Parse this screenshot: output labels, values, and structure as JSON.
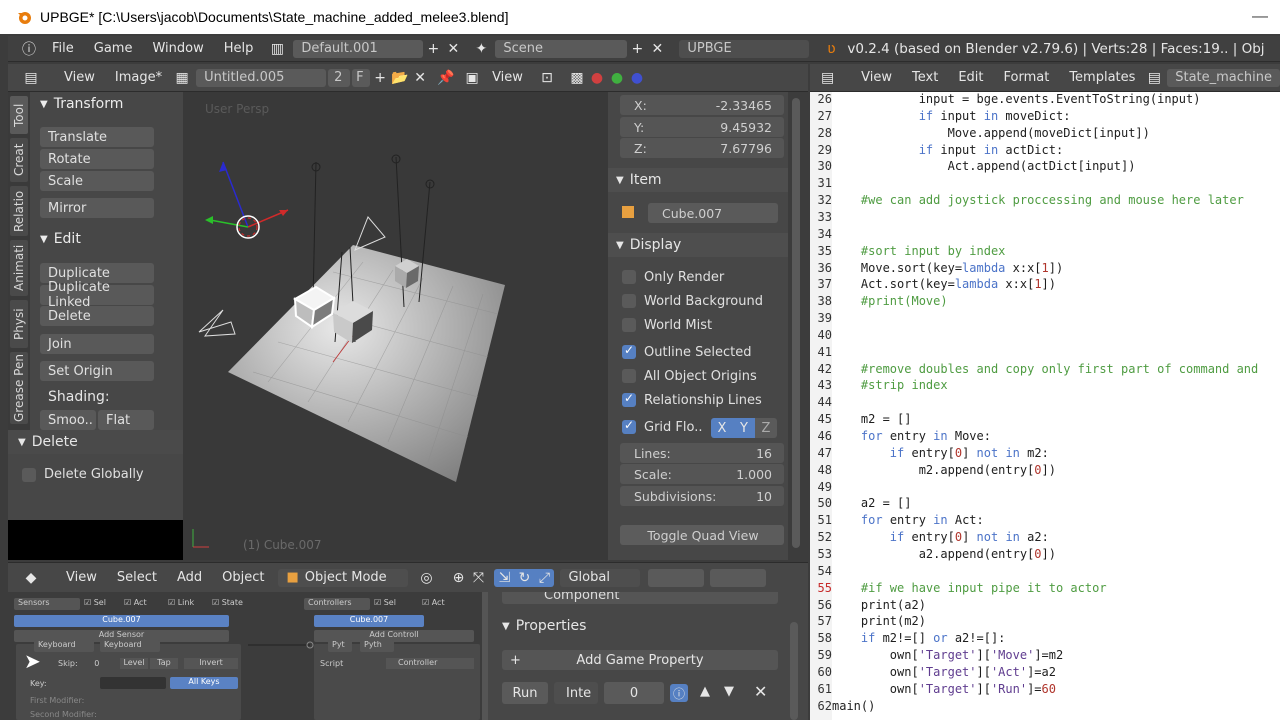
{
  "window": {
    "title": "UPBGE* [C:\\Users\\jacob\\Documents\\State_machine_added_melee3.blend]"
  },
  "infobar": {
    "menus": [
      "File",
      "Game",
      "Window",
      "Help"
    ],
    "layout": "Default.001",
    "scene": "Scene",
    "engine": "UPBGE",
    "version_info": "v0.2.4 (based on Blender v2.79.6)  | Verts:28 | Faces:19.. | Obj"
  },
  "image_header": {
    "view": "View",
    "image": "Image*",
    "image_name": "Untitled.005",
    "users": "2",
    "fake": "F",
    "view2": "View"
  },
  "tabs": [
    "Tool",
    "Creat",
    "Relatio",
    "Animati",
    "Physi",
    "Grease Pen"
  ],
  "toolshelf": {
    "transform_title": "Transform",
    "translate": "Translate",
    "rotate": "Rotate",
    "scale": "Scale",
    "mirror": "Mirror",
    "edit_title": "Edit",
    "duplicate": "Duplicate",
    "duplicate_linked": "Duplicate Linked",
    "delete": "Delete",
    "join": "Join",
    "set_origin": "Set Origin",
    "shading": "Shading:",
    "smooth": "Smoo..",
    "flat": "Flat",
    "delete_panel": "Delete",
    "delete_globally": "Delete Globally"
  },
  "viewport": {
    "persp_label": "User Persp",
    "object_label": "(1) Cube.007"
  },
  "npanel": {
    "x_label": "X:",
    "x_value": "-2.33465",
    "y_label": "Y:",
    "y_value": "9.45932",
    "z_label": "Z:",
    "z_value": "7.67796",
    "item_title": "Item",
    "item_name": "Cube.007",
    "display_title": "Display",
    "only_render": "Only Render",
    "world_background": "World Background",
    "world_mist": "World Mist",
    "outline_selected": "Outline Selected",
    "all_object_origins": "All Object Origins",
    "relationship_lines": "Relationship Lines",
    "grid_floor": "Grid Flo..",
    "axis_x": "X",
    "axis_y": "Y",
    "axis_z": "Z",
    "lines_label": "Lines:",
    "lines_value": "16",
    "scale_label": "Scale:",
    "scale_value": "1.000",
    "subdiv_label": "Subdivisions:",
    "subdiv_value": "10",
    "toggle_quad": "Toggle Quad View"
  },
  "view3d_header": {
    "view": "View",
    "select": "Select",
    "add": "Add",
    "object": "Object",
    "mode": "Object Mode",
    "orientation": "Global"
  },
  "logic": {
    "sensors": "Sensors",
    "sel": "Sel",
    "act": "Act",
    "link": "Link",
    "state": "State",
    "controllers": "Controllers",
    "sel2": "Sel",
    "act2": "Act",
    "obj": "Cube.007",
    "obj2": "Cube.007",
    "add_sensor": "Add Sensor",
    "add_controller": "Add Controll",
    "keyboard": "Keyboard",
    "keyboard2": "Keyboard",
    "skip": "Skip:",
    "skip_val": "0",
    "level": "Level",
    "tap": "Tap",
    "invert": "Invert",
    "key": "Key:",
    "all_keys": "All Keys",
    "first_mod": "First Modifier:",
    "second_mod": "Second Modifier:",
    "pyt": "Pyt",
    "pyth": "Pyth",
    "script": "Script",
    "controller": "Controller"
  },
  "props_bottom": {
    "component": "Component",
    "properties_title": "Properties",
    "add_prop": "Add Game Property",
    "run": "Run",
    "inte": "Inte",
    "value": "0"
  },
  "text_header": {
    "view": "View",
    "text": "Text",
    "edit": "Edit",
    "format": "Format",
    "templates": "Templates",
    "file": "State_machine"
  },
  "code": [
    {
      "n": "26",
      "t": "            input = bge.events.EventToString(input)"
    },
    {
      "n": "27",
      "t": "            if input in moveDict:"
    },
    {
      "n": "28",
      "t": "                Move.append(moveDict[input])"
    },
    {
      "n": "29",
      "t": "            if input in actDict:"
    },
    {
      "n": "30",
      "t": "                Act.append(actDict[input])"
    },
    {
      "n": "31",
      "t": ""
    },
    {
      "n": "32",
      "t": "    #we can add joystick proccessing and mouse here later"
    },
    {
      "n": "33",
      "t": ""
    },
    {
      "n": "34",
      "t": ""
    },
    {
      "n": "35",
      "t": "    #sort input by index"
    },
    {
      "n": "36",
      "t": "    Move.sort(key=lambda x:x[1])"
    },
    {
      "n": "37",
      "t": "    Act.sort(key=lambda x:x[1])"
    },
    {
      "n": "38",
      "t": "    #print(Move)"
    },
    {
      "n": "39",
      "t": ""
    },
    {
      "n": "40",
      "t": ""
    },
    {
      "n": "41",
      "t": ""
    },
    {
      "n": "42",
      "t": "    #remove doubles and copy only first part of command and"
    },
    {
      "n": "43",
      "t": "    #strip index"
    },
    {
      "n": "44",
      "t": ""
    },
    {
      "n": "45",
      "t": "    m2 = []"
    },
    {
      "n": "46",
      "t": "    for entry in Move:"
    },
    {
      "n": "47",
      "t": "        if entry[0] not in m2:"
    },
    {
      "n": "48",
      "t": "            m2.append(entry[0])"
    },
    {
      "n": "49",
      "t": ""
    },
    {
      "n": "50",
      "t": "    a2 = []"
    },
    {
      "n": "51",
      "t": "    for entry in Act:"
    },
    {
      "n": "52",
      "t": "        if entry[0] not in a2:"
    },
    {
      "n": "53",
      "t": "            a2.append(entry[0])"
    },
    {
      "n": "54",
      "t": ""
    },
    {
      "n": "55",
      "t": "    #if we have input pipe it to actor"
    },
    {
      "n": "56",
      "t": "    print(a2)"
    },
    {
      "n": "57",
      "t": "    print(m2)"
    },
    {
      "n": "58",
      "t": "    if m2!=[] or a2!=[]:"
    },
    {
      "n": "59",
      "t": "        own['Target']['Move']=m2"
    },
    {
      "n": "60",
      "t": "        own['Target']['Act']=a2"
    },
    {
      "n": "61",
      "t": "        own['Target']['Run']=60"
    },
    {
      "n": "62",
      "t": "main()"
    }
  ],
  "colors": {
    "keyword": "#4b73c8",
    "comment": "#4f9c42",
    "number": "#b0352c",
    "current_line_number": "#c62a2a",
    "checkbox_on": "#5680c2"
  }
}
